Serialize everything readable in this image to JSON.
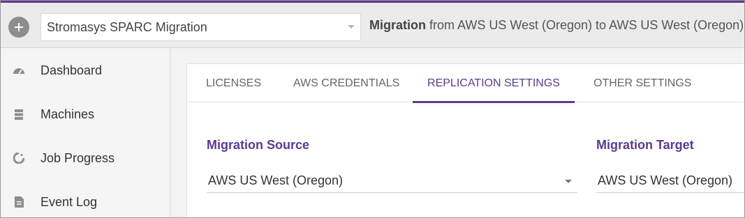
{
  "header": {
    "add_icon": "plus-icon",
    "project": {
      "selected": "Stromasys SPARC Migration",
      "icon": "chevron-down-icon"
    },
    "migration_desc": {
      "bold": "Migration",
      "rest": " from AWS US West (Oregon) to AWS US West (Oregon)"
    }
  },
  "sidebar": {
    "items": [
      {
        "label": "Dashboard",
        "icon": "dashboard-gauge-icon"
      },
      {
        "label": "Machines",
        "icon": "server-stack-icon"
      },
      {
        "label": "Job Progress",
        "icon": "progress-circle-icon"
      },
      {
        "label": "Event Log",
        "icon": "document-icon"
      }
    ]
  },
  "tabs": [
    {
      "label": "LICENSES",
      "active": false
    },
    {
      "label": "AWS CREDENTIALS",
      "active": false
    },
    {
      "label": "REPLICATION SETTINGS",
      "active": true
    },
    {
      "label": "OTHER SETTINGS",
      "active": false
    }
  ],
  "replication": {
    "source": {
      "title": "Migration Source",
      "value": "AWS US West (Oregon)"
    },
    "target": {
      "title": "Migration Target",
      "value": "AWS US West (Oregon)"
    }
  },
  "colors": {
    "accent": "#5c3a8e",
    "header_bg": "#ebebeb",
    "sidebar_bg": "#f5f5f5",
    "icon_gray": "#8d8d8d"
  }
}
